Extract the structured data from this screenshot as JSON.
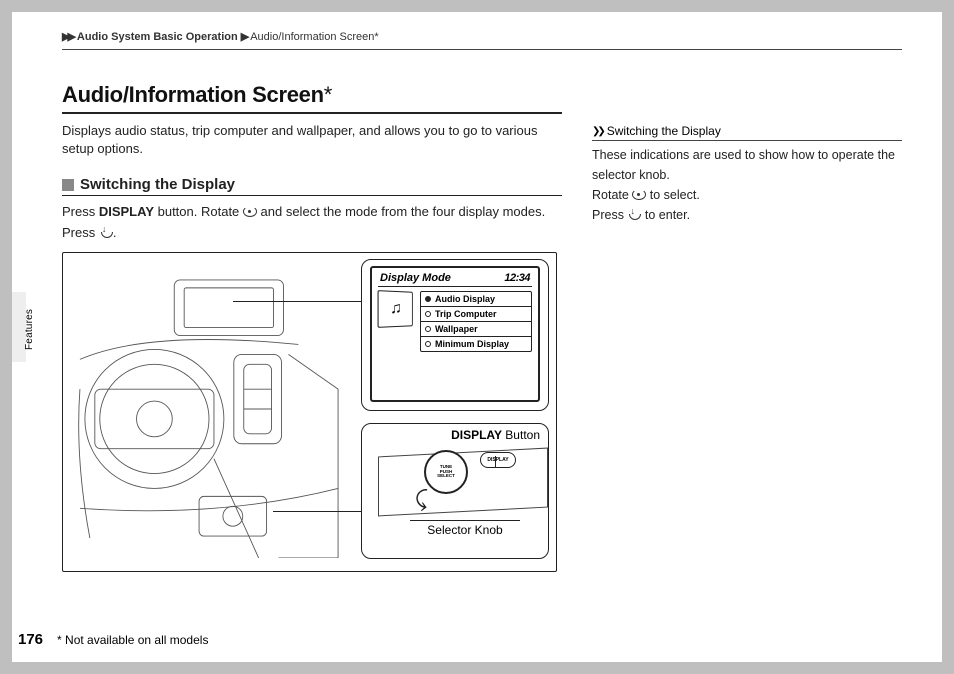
{
  "breadcrumb": {
    "seg1": "Audio System Basic Operation",
    "seg2": "Audio/Information Screen",
    "ast": "*"
  },
  "title": "Audio/Information Screen",
  "title_ast": "*",
  "intro": "Displays audio status, trip computer and wallpaper, and allows you to go to various setup options.",
  "section": {
    "heading": "Switching the Display",
    "line1_pre": "Press ",
    "line1_btn": "DISPLAY",
    "line1_mid": " button. Rotate ",
    "line1_post": " and select the mode from the four display modes.",
    "line2_pre": "Press ",
    "line2_post": "."
  },
  "screen": {
    "head": "Display Mode",
    "time": "12:34",
    "opts": [
      "Audio Display",
      "Trip Computer",
      "Wallpaper",
      "Minimum Display"
    ]
  },
  "callouts": {
    "display_btn_label_b": "DISPLAY",
    "display_btn_label_t": " Button",
    "knob_center": "TUNE\nPUSH\nSELECT",
    "disp_small": "DISPLAY",
    "selector": "Selector Knob"
  },
  "sidebar": {
    "head": "Switching the Display",
    "p1": "These indications are used to show how to operate the selector knob.",
    "p2_pre": "Rotate ",
    "p2_post": " to select.",
    "p3_pre": "Press ",
    "p3_post": " to enter."
  },
  "tab": "Features",
  "footer": {
    "page": "176",
    "note": "* Not available on all models"
  }
}
